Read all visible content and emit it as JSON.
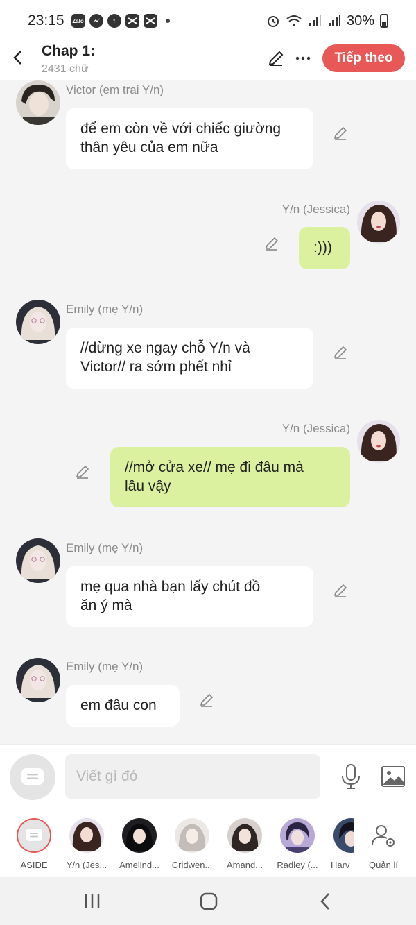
{
  "status_bar": {
    "time": "23:15",
    "app_icons": [
      "zalo-icon",
      "messenger-icon",
      "facebook-icon",
      "capcut-icon",
      "capcut-icon"
    ],
    "battery": "30%"
  },
  "header": {
    "title": "Chap 1:",
    "subtitle": "2431 chữ",
    "next_label": "Tiếp theo"
  },
  "messages": [
    {
      "side": "left",
      "name": "Victor (em trai Y/n)",
      "text_lines": [
        "để em còn về với chiếc giường",
        "thân yêu của em nữa"
      ],
      "color": "white",
      "avatar": "victor"
    },
    {
      "side": "right",
      "name": "Y/n (Jessica)",
      "text_lines": [
        ":)))"
      ],
      "color": "green",
      "avatar": "jessica"
    },
    {
      "side": "left",
      "name": "Emily (mẹ Y/n)",
      "text_lines": [
        "//dừng xe ngay chỗ Y/n và",
        "Victor// ra sớm phết nhỉ"
      ],
      "color": "white",
      "avatar": "emily"
    },
    {
      "side": "right",
      "name": "Y/n (Jessica)",
      "text_lines": [
        "//mở cửa xe// mẹ đi đâu mà",
        "lâu vậy"
      ],
      "color": "green",
      "avatar": "jessica"
    },
    {
      "side": "left",
      "name": "Emily (mẹ Y/n)",
      "text_lines": [
        "mẹ qua nhà bạn lấy chút đồ",
        "ăn ý mà"
      ],
      "color": "white",
      "avatar": "emily"
    },
    {
      "side": "left",
      "name": "Emily (mẹ Y/n)",
      "text_lines": [
        "em đâu con"
      ],
      "color": "white",
      "avatar": "emily"
    }
  ],
  "input": {
    "placeholder": "Viết gì đó"
  },
  "characters": [
    {
      "label": "ASIDE"
    },
    {
      "label": "Y/n (Jes..."
    },
    {
      "label": "Amelind..."
    },
    {
      "label": "Cridwen..."
    },
    {
      "label": "Amand..."
    },
    {
      "label": "Radley (..."
    },
    {
      "label": "Harv"
    },
    {
      "label": "Quản lí"
    }
  ],
  "colors": {
    "accent": "#e85856",
    "bubble_green": "#dcf19f",
    "bubble_white": "#ffffff",
    "background": "#f4f4f4"
  }
}
